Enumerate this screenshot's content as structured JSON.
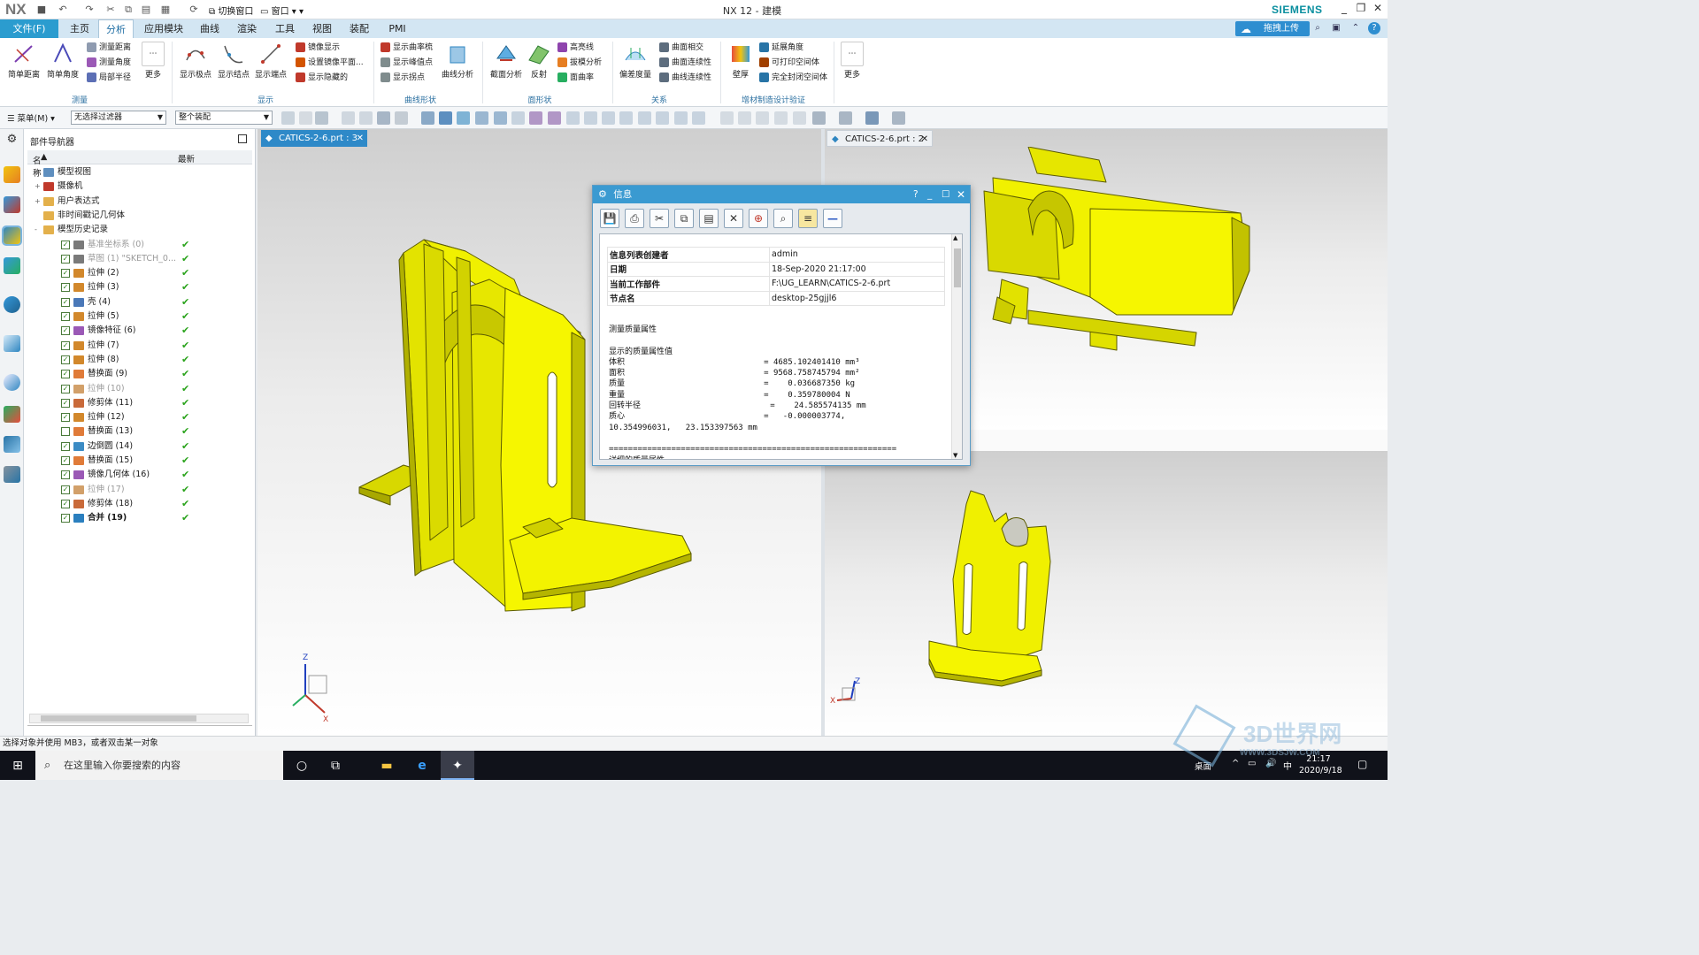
{
  "app": {
    "logo": "NX",
    "window_title": "NX 12 - 建模",
    "brand": "SIEMENS"
  },
  "menu": {
    "file": "文件(F)",
    "tabs": [
      "主页",
      "分析",
      "应用模块",
      "曲线",
      "渲染",
      "工具",
      "视图",
      "装配",
      "PMI"
    ],
    "active_tab": "分析",
    "upload_button": "拖拽上传"
  },
  "ribbon": {
    "measure": {
      "large": [
        "简单距离",
        "简单角度"
      ],
      "small": [
        "测量距离",
        "测量角度",
        "局部半径"
      ],
      "more": "更多",
      "group": "测量"
    },
    "display": {
      "large": [
        "显示极点",
        "显示结点",
        "显示端点"
      ],
      "small": [
        "镜像显示",
        "设置镜像平面...",
        "显示隐藏的"
      ],
      "group": "显示"
    },
    "curve_shape": {
      "small": [
        "显示曲率梳",
        "显示峰值点",
        "显示拐点"
      ],
      "large": [
        "曲线分析"
      ],
      "group": "曲线形状"
    },
    "face_shape": {
      "large": [
        "截面分析",
        "反射"
      ],
      "small": [
        "高亮线",
        "拔模分析",
        "面曲率"
      ],
      "group": "面形状"
    },
    "relation": {
      "large": [
        "偏差度量"
      ],
      "small": [
        "曲面相交",
        "曲面连续性",
        "曲线连续性"
      ],
      "group": "关系"
    },
    "additive": {
      "large": [
        "壁厚"
      ],
      "small": [
        "延展角度",
        "可打印空间体",
        "完全封闭空间体"
      ],
      "group": "增材制造设计验证"
    },
    "more": "更多"
  },
  "toolbar": {
    "menu": "菜单(M)",
    "filter": "无选择过滤器",
    "scope": "整个装配"
  },
  "navigator": {
    "title": "部件导航器",
    "col_name": "名称",
    "col_latest": "最新",
    "rows": [
      {
        "label": "模型视图",
        "level": 0,
        "expand": "+",
        "checkbox": false,
        "ok": false,
        "dim": false,
        "bold": false,
        "icon": "#5f8fbf"
      },
      {
        "label": "摄像机",
        "level": 0,
        "expand": "+",
        "checkbox": false,
        "ok": false,
        "dim": false,
        "bold": false,
        "icon": "#c0392b"
      },
      {
        "label": "用户表达式",
        "level": 0,
        "expand": "+",
        "checkbox": false,
        "ok": false,
        "dim": false,
        "bold": false,
        "icon": "#e3b04b"
      },
      {
        "label": "非时间戳记几何体",
        "level": 0,
        "expand": "",
        "checkbox": false,
        "ok": false,
        "dim": false,
        "bold": false,
        "icon": "#e3b04b"
      },
      {
        "label": "模型历史记录",
        "level": 0,
        "expand": "-",
        "checkbox": false,
        "ok": false,
        "dim": false,
        "bold": false,
        "icon": "#e3b04b"
      },
      {
        "label": "基准坐标系 (0)",
        "level": 1,
        "expand": "",
        "checkbox": true,
        "ok": true,
        "dim": true,
        "bold": false,
        "icon": "#7a7a7a"
      },
      {
        "label": "草图 (1) \"SKETCH_0...",
        "level": 1,
        "expand": "",
        "checkbox": true,
        "ok": true,
        "dim": true,
        "bold": false,
        "icon": "#7a7a7a"
      },
      {
        "label": "拉伸 (2)",
        "level": 1,
        "expand": "",
        "checkbox": true,
        "ok": true,
        "dim": false,
        "bold": false,
        "icon": "#d2882c"
      },
      {
        "label": "拉伸 (3)",
        "level": 1,
        "expand": "",
        "checkbox": true,
        "ok": true,
        "dim": false,
        "bold": false,
        "icon": "#d2882c"
      },
      {
        "label": "壳 (4)",
        "level": 1,
        "expand": "",
        "checkbox": true,
        "ok": true,
        "dim": false,
        "bold": false,
        "icon": "#4a78b8"
      },
      {
        "label": "拉伸 (5)",
        "level": 1,
        "expand": "",
        "checkbox": true,
        "ok": true,
        "dim": false,
        "bold": false,
        "icon": "#d2882c"
      },
      {
        "label": "镜像特征 (6)",
        "level": 1,
        "expand": "",
        "checkbox": true,
        "ok": true,
        "dim": false,
        "bold": false,
        "icon": "#9b59b6"
      },
      {
        "label": "拉伸 (7)",
        "level": 1,
        "expand": "",
        "checkbox": true,
        "ok": true,
        "dim": false,
        "bold": false,
        "icon": "#d2882c"
      },
      {
        "label": "拉伸 (8)",
        "level": 1,
        "expand": "",
        "checkbox": true,
        "ok": true,
        "dim": false,
        "bold": false,
        "icon": "#d2882c"
      },
      {
        "label": "替换面 (9)",
        "level": 1,
        "expand": "",
        "checkbox": true,
        "ok": true,
        "dim": false,
        "bold": false,
        "icon": "#e07b39"
      },
      {
        "label": "拉伸 (10)",
        "level": 1,
        "expand": "",
        "checkbox": true,
        "ok": true,
        "dim": true,
        "bold": false,
        "icon": "#d2a06a"
      },
      {
        "label": "修剪体 (11)",
        "level": 1,
        "expand": "",
        "checkbox": true,
        "ok": true,
        "dim": false,
        "bold": false,
        "icon": "#c96a3a"
      },
      {
        "label": "拉伸 (12)",
        "level": 1,
        "expand": "",
        "checkbox": true,
        "ok": true,
        "dim": false,
        "bold": false,
        "icon": "#d2882c"
      },
      {
        "label": "替换面 (13)",
        "level": 1,
        "expand": "",
        "checkbox": false,
        "ok": true,
        "dim": false,
        "bold": false,
        "icon": "#e07b39"
      },
      {
        "label": "边倒圆 (14)",
        "level": 1,
        "expand": "",
        "checkbox": true,
        "ok": true,
        "dim": false,
        "bold": false,
        "icon": "#3b8bc4"
      },
      {
        "label": "替换面 (15)",
        "level": 1,
        "expand": "",
        "checkbox": true,
        "ok": true,
        "dim": false,
        "bold": false,
        "icon": "#e07b39"
      },
      {
        "label": "镜像几何体 (16)",
        "level": 1,
        "expand": "",
        "checkbox": true,
        "ok": true,
        "dim": false,
        "bold": false,
        "icon": "#9b59b6"
      },
      {
        "label": "拉伸 (17)",
        "level": 1,
        "expand": "",
        "checkbox": true,
        "ok": true,
        "dim": true,
        "bold": false,
        "icon": "#d2a06a"
      },
      {
        "label": "修剪体 (18)",
        "level": 1,
        "expand": "",
        "checkbox": true,
        "ok": true,
        "dim": false,
        "bold": false,
        "icon": "#c96a3a"
      },
      {
        "label": "合并 (19)",
        "level": 1,
        "expand": "",
        "checkbox": true,
        "ok": true,
        "dim": false,
        "bold": true,
        "icon": "#2a7fbf"
      }
    ]
  },
  "viewports": {
    "left_tab": "CATICS-2-6.prt : 3",
    "right_tab": "CATICS-2-6.prt : 2",
    "model_color": "#ecec00",
    "active_tab_color": "#2e89c8"
  },
  "info": {
    "title": "信息",
    "table": [
      {
        "k": "信息列表创建者",
        "v": "admin"
      },
      {
        "k": "日期",
        "v": "18-Sep-2020 21:17:00"
      },
      {
        "k": "当前工作部件",
        "v": "F:\\UG_LEARN\\CATICS-2-6.prt"
      },
      {
        "k": "节点名",
        "v": "desktop-25gjjl6"
      }
    ],
    "report": "测量质量属性\n\n显示的质量属性值\n体积                             = 4685.102401410 mm³\n面积                             = 9568.758745794 mm²\n质量                             =    0.036687350 kg\n重量                             =    0.359780004 N\n回转半径                           =    24.585574135 mm\n质心                             =   -0.000003774,\n10.354996031,   23.153397563 mm\n\n============================================================\n详细的质量属性"
  },
  "status": "选择对象并使用 MB3，或者双击某一对象",
  "taskbar": {
    "search_placeholder": "在这里输入你要搜索的内容",
    "desktop_label": "桌面",
    "time": "21:17",
    "date": "2020/9/18",
    "ime": "中"
  },
  "watermark": {
    "text": "3D世界网",
    "url": "WWW.3DSJW.COM"
  }
}
